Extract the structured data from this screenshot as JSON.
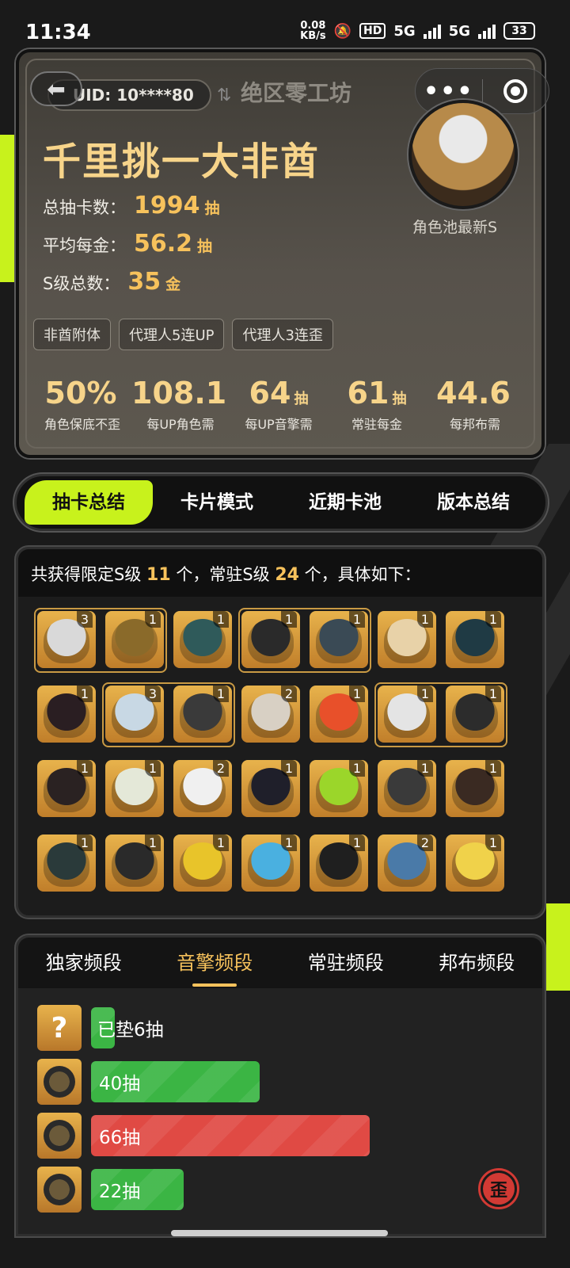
{
  "status_bar": {
    "time": "11:34",
    "net_speed": "0.08",
    "net_unit": "KB/s",
    "hd": "HD",
    "signal1": "5G",
    "signal2": "5G",
    "battery": "33"
  },
  "header": {
    "uid": "UID: 10****80",
    "club_name": "绝区零工坊"
  },
  "profile": {
    "title": "千里挑一大非酋",
    "stats": [
      {
        "label": "总抽卡数：",
        "value": "1994",
        "unit": "抽"
      },
      {
        "label": "平均每金：",
        "value": "56.2",
        "unit": "抽"
      },
      {
        "label": "S级总数：",
        "value": "35",
        "unit": "金"
      }
    ],
    "avatar_label": "角色池最新S",
    "tags": [
      "非酋附体",
      "代理人5连UP",
      "代理人3连歪"
    ],
    "kpis": [
      {
        "value": "50%",
        "unit": "",
        "label": "角色保底不歪"
      },
      {
        "value": "108.1",
        "unit": "",
        "label": "每UP角色需"
      },
      {
        "value": "64",
        "unit": "抽",
        "label": "每UP音擎需"
      },
      {
        "value": "61",
        "unit": "抽",
        "label": "常驻每金"
      },
      {
        "value": "44.6",
        "unit": "",
        "label": "每邦布需"
      }
    ]
  },
  "tabs": [
    "抽卡总结",
    "卡片模式",
    "近期卡池",
    "版本总结"
  ],
  "results": {
    "prefix": "共获得限定S级 ",
    "limited_count": "11",
    "middle": " 个，常驻S级 ",
    "standard_count": "24",
    "suffix": " 个，具体如下："
  },
  "items": [
    {
      "name": "char-1",
      "count": "3",
      "color": "#d9d9d9"
    },
    {
      "name": "engine-1",
      "count": "1",
      "color": "#8a6a2a"
    },
    {
      "name": "char-2",
      "count": "1",
      "color": "#2f5a5a"
    },
    {
      "name": "char-3",
      "count": "1",
      "color": "#2a2a2a"
    },
    {
      "name": "engine-2",
      "count": "1",
      "color": "#3a4a55"
    },
    {
      "name": "char-4",
      "count": "1",
      "color": "#e8d2a8"
    },
    {
      "name": "char-5",
      "count": "1",
      "color": "#1f3a44"
    },
    {
      "name": "char-6",
      "count": "1",
      "color": "#2a1e22"
    },
    {
      "name": "char-7",
      "count": "3",
      "color": "#c8d8e4"
    },
    {
      "name": "engine-3",
      "count": "1",
      "color": "#3a3a3a"
    },
    {
      "name": "char-8",
      "count": "2",
      "color": "#d8d0c4"
    },
    {
      "name": "char-9",
      "count": "1",
      "color": "#e8502a"
    },
    {
      "name": "char-10",
      "count": "1",
      "color": "#e4e4e4"
    },
    {
      "name": "engine-4",
      "count": "1",
      "color": "#2c2c2c"
    },
    {
      "name": "char-11",
      "count": "1",
      "color": "#2a2222"
    },
    {
      "name": "bangboo-1",
      "count": "1",
      "color": "#e4e8d8"
    },
    {
      "name": "bangboo-2",
      "count": "2",
      "color": "#f0f0f0"
    },
    {
      "name": "bangboo-3",
      "count": "1",
      "color": "#1f1f2a"
    },
    {
      "name": "bangboo-4",
      "count": "1",
      "color": "#9bd62a"
    },
    {
      "name": "bangboo-5",
      "count": "1",
      "color": "#3a3a3a"
    },
    {
      "name": "bangboo-6",
      "count": "1",
      "color": "#3a2a22"
    },
    {
      "name": "bangboo-7",
      "count": "1",
      "color": "#2a3a3a"
    },
    {
      "name": "bangboo-8",
      "count": "1",
      "color": "#2a2a2a"
    },
    {
      "name": "bangboo-9",
      "count": "1",
      "color": "#e8c42a"
    },
    {
      "name": "bangboo-10",
      "count": "1",
      "color": "#4ab0e0"
    },
    {
      "name": "bangboo-11",
      "count": "1",
      "color": "#1f1f1f"
    },
    {
      "name": "bangboo-12",
      "count": "2",
      "color": "#4a7aa8"
    },
    {
      "name": "bangboo-13",
      "count": "1",
      "color": "#f0d24a"
    }
  ],
  "sub_tabs": [
    "独家频段",
    "音擎频段",
    "常驻频段",
    "邦布频段"
  ],
  "pity": [
    {
      "icon": "?",
      "label": "已垫6抽",
      "pulls": 6,
      "status": "green"
    },
    {
      "icon": "",
      "label": "40抽",
      "pulls": 40,
      "status": "green"
    },
    {
      "icon": "",
      "label": "66抽",
      "pulls": 66,
      "status": "red"
    },
    {
      "icon": "",
      "label": "22抽",
      "pulls": 22,
      "status": "green"
    }
  ],
  "badge": "歪"
}
